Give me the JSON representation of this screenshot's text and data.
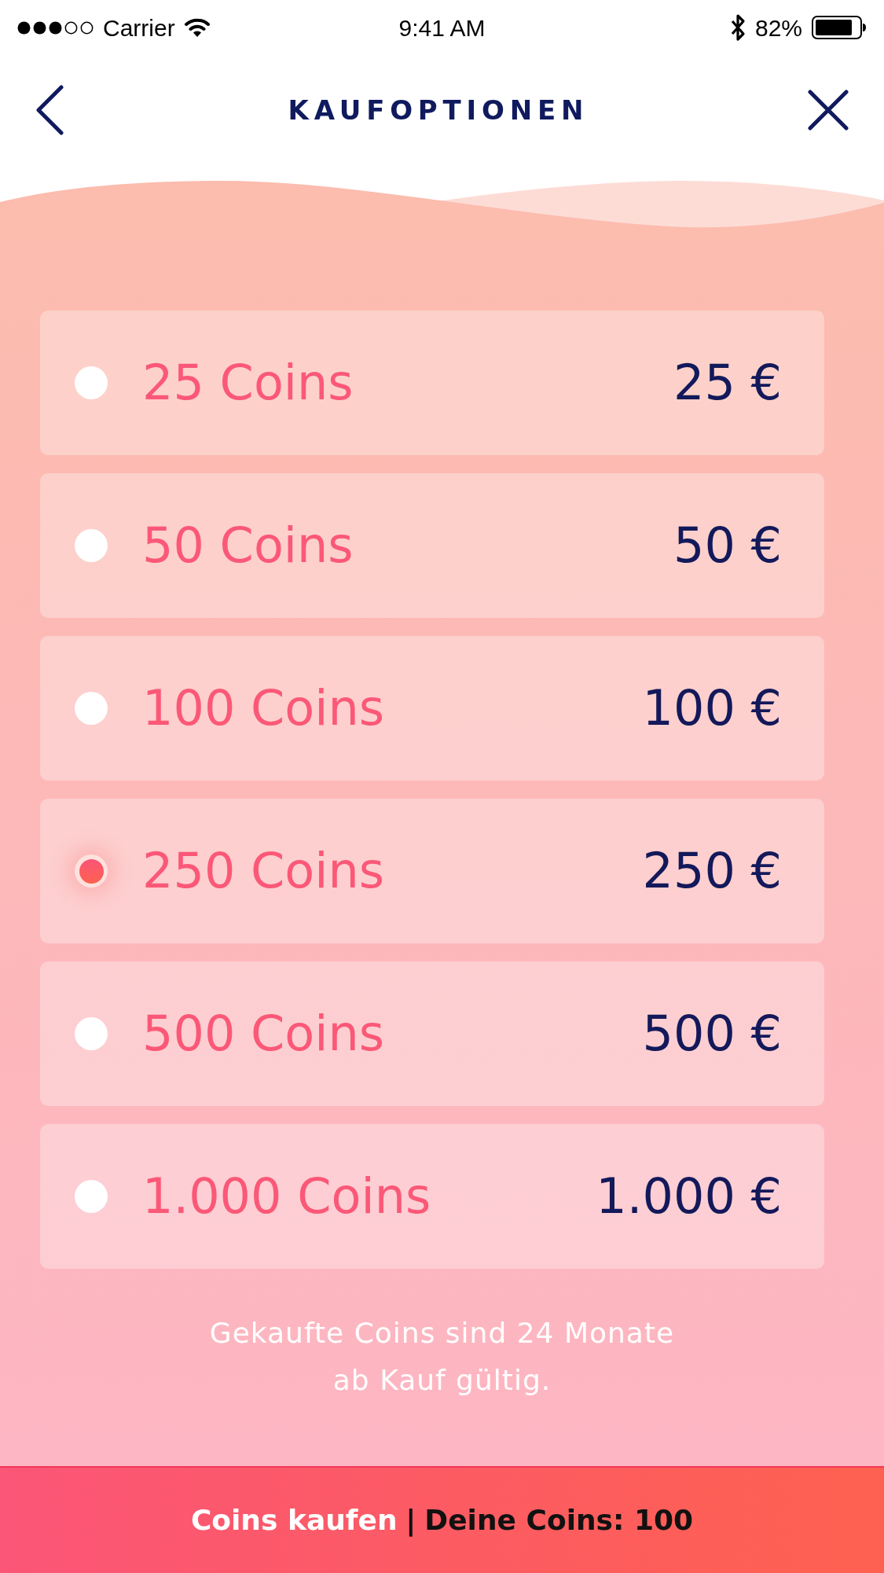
{
  "status_bar": {
    "carrier": "Carrier",
    "time": "9:41 AM",
    "battery": "82%"
  },
  "header": {
    "title": "KAUFOPTIONEN"
  },
  "options": [
    {
      "coins": "25 Coins",
      "price": "25 €",
      "selected": false
    },
    {
      "coins": "50 Coins",
      "price": "50 €",
      "selected": false
    },
    {
      "coins": "100 Coins",
      "price": "100 €",
      "selected": false
    },
    {
      "coins": "250 Coins",
      "price": "250 €",
      "selected": true
    },
    {
      "coins": "500 Coins",
      "price": "500 €",
      "selected": false
    },
    {
      "coins": "1.000 Coins",
      "price": "1.000 €",
      "selected": false
    }
  ],
  "note": "Gekaufte Coins sind 24 Monate ab Kauf gültig.",
  "buy_button": {
    "label": "Coins kaufen",
    "separator": "|",
    "balance": "Deine Coins: 100"
  }
}
